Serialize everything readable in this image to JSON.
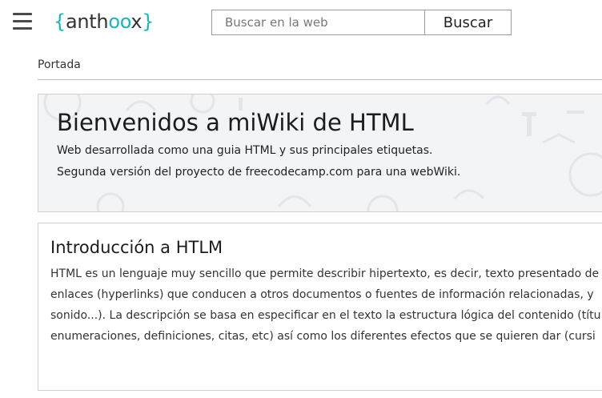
{
  "header": {
    "logo": {
      "open_brace": "{",
      "text_start": "anth",
      "text_accent": "oo",
      "text_end": "x",
      "close_brace": "}"
    },
    "search": {
      "placeholder": "Buscar en la web",
      "button_label": "Buscar"
    }
  },
  "breadcrumb": "Portada",
  "hero": {
    "title": "Bienvenidos a miWiki de HTML",
    "lines": [
      "Web desarrollada como una guia HTML y sus principales etiquetas.",
      "Segunda versión del proyecto de freecodecamp.com para una webWiki."
    ]
  },
  "section": {
    "title": "Introducción a HTLM",
    "lines": [
      "HTML es un lenguaje muy sencillo que permite describir hipertexto, es decir, texto presentado de",
      "enlaces (hyperlinks) que conducen a otros documentos o fuentes de información relacionadas, y",
      "sonido...). La descripción se basa en especificar en el texto la estructura lógica del contenido (títu",
      "enumeraciones, definiciones, citas, etc) así como los diferentes efectos que se quieren dar (cursi"
    ]
  },
  "colors": {
    "accent": "#15b8b8",
    "hero_bg": "#f3f4f6",
    "border": "#d0d0d0"
  },
  "icons": {
    "menu": "hamburger-menu-icon"
  }
}
